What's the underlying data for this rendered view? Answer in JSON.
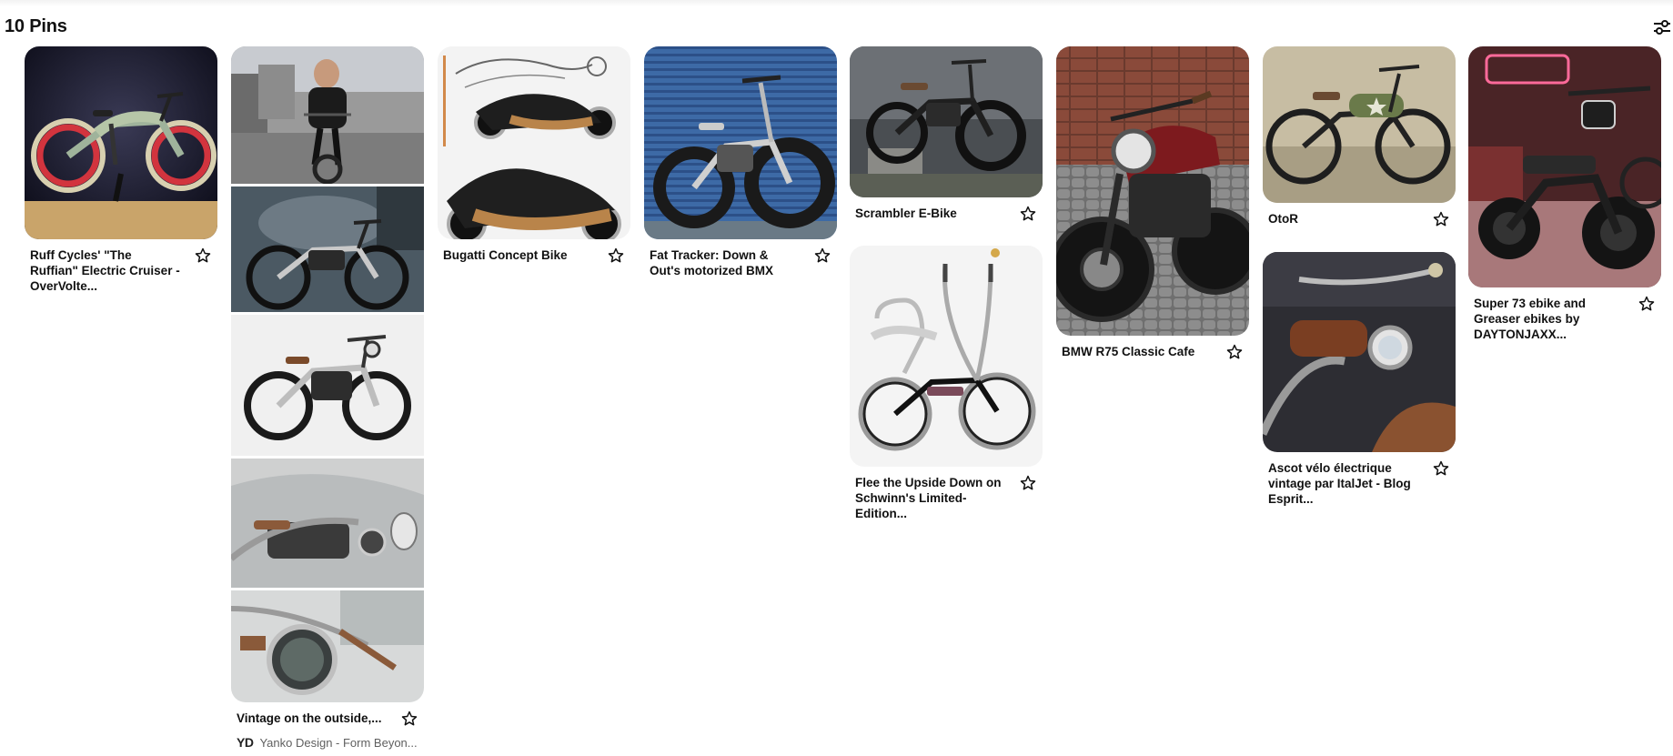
{
  "header": {
    "title": "10 Pins",
    "filter_icon": "sliders-icon"
  },
  "pins": [
    {
      "title": "Ruff Cycles' \"The Ruffian\" Electric Cruiser - OverVolte...",
      "icon": "star-icon"
    },
    {
      "title": "Vintage on the outside,...",
      "source_logo": "YD",
      "source": "Yanko Design - Form Beyon...",
      "icon": "star-icon"
    },
    {
      "title": "Bugatti Concept Bike",
      "icon": "star-icon"
    },
    {
      "title": "Fat Tracker: Down & Out's motorized BMX",
      "icon": "star-icon"
    },
    {
      "title": "Scrambler E-Bike",
      "icon": "star-icon"
    },
    {
      "title": "Flee the Upside Down on Schwinn's Limited-Edition...",
      "icon": "star-icon"
    },
    {
      "title": "BMW R75 Classic Cafe",
      "icon": "star-icon"
    },
    {
      "title": "OtoR",
      "icon": "star-icon"
    },
    {
      "title": "Ascot vélo électrique vintage par ItalJet - Blog Esprit...",
      "icon": "star-icon"
    },
    {
      "title": "Super 73 ebike and Greaser ebikes by DAYTONJAXX...",
      "icon": "star-icon"
    }
  ]
}
